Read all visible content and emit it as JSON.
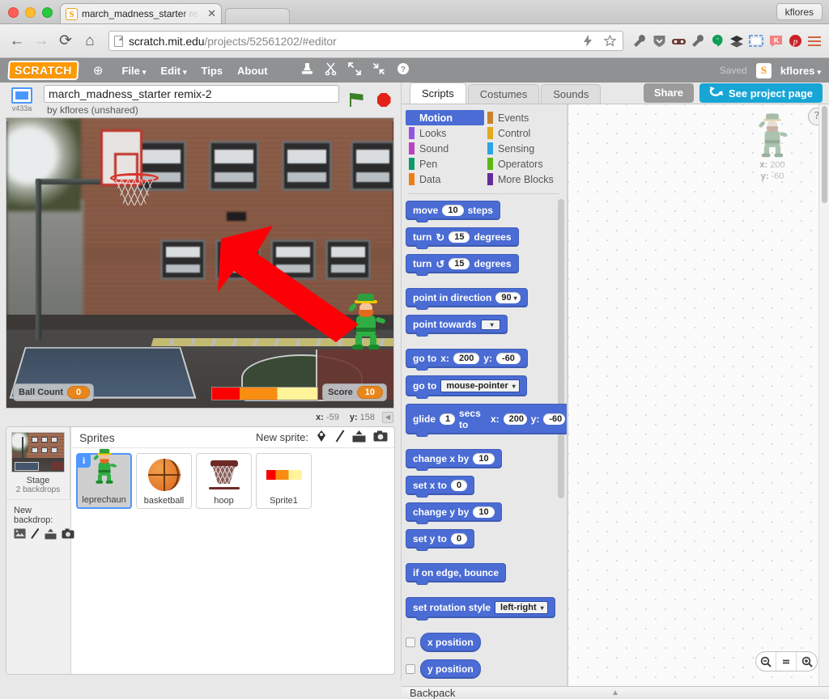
{
  "browser": {
    "tab": {
      "title_main": "march_madness_starter",
      "title_dim": " re",
      "close": "✕",
      "favicon": "S"
    },
    "profile_chip": "kflores",
    "back_icon": "←",
    "forward_icon": "→",
    "reload_icon": "⟳",
    "home_icon": "⌂",
    "url_main": "scratch.mit.edu",
    "url_dim": "/projects/52561202/#editor",
    "extensions": [
      "lightning-icon",
      "star-icon",
      "wrench-icon",
      "shield-icon",
      "mask-icon",
      "wrench2-icon",
      "hangouts-icon",
      "layers-icon",
      "window-icon",
      "k-icon",
      "pinterest-icon",
      "menu-icon"
    ]
  },
  "scratch_menu": {
    "logo": "SCRATCH",
    "globe_icon": "⊕",
    "items": [
      {
        "label": "File",
        "caret": "▾"
      },
      {
        "label": "Edit",
        "caret": "▾"
      },
      {
        "label": "Tips",
        "caret": ""
      },
      {
        "label": "About",
        "caret": ""
      }
    ],
    "tools": [
      "stamp-icon",
      "scissors-icon",
      "grow-icon",
      "shrink-icon",
      "help-icon"
    ],
    "saved_status": "Saved",
    "user_badge": "S",
    "username": "kflores",
    "username_caret": "▾"
  },
  "project": {
    "version_label": "v433a",
    "title_value": "march_madness_starter remix-2",
    "title_placeholder": "Project title",
    "byline": "by kflores (unshared)",
    "green_flag": "green-flag",
    "stop": "stop-sign"
  },
  "stage": {
    "watchers": [
      {
        "label": "Ball Count",
        "value": "0"
      },
      {
        "label": "Score",
        "value": "10"
      }
    ],
    "mouse_x_label": "x:",
    "mouse_x": "-59",
    "mouse_y_label": "y:",
    "mouse_y": "158",
    "collapse_arrow": "◀"
  },
  "sprite_pane": {
    "stage_name": "Stage",
    "stage_sub": "2 backdrops",
    "sprites_title": "Sprites",
    "new_sprite_label": "New sprite:",
    "new_sprite_icons": [
      "library-icon",
      "paint-icon",
      "upload-icon",
      "camera-icon"
    ],
    "new_backdrop_label": "New backdrop:",
    "new_backdrop_icons": [
      "library-icon",
      "paint-icon",
      "upload-icon",
      "camera-icon"
    ],
    "sprites": [
      {
        "name": "leprechaun",
        "selected": true,
        "badge": "i"
      },
      {
        "name": "basketball",
        "selected": false
      },
      {
        "name": "hoop",
        "selected": false
      },
      {
        "name": "Sprite1",
        "selected": false
      }
    ]
  },
  "editor": {
    "tabs": [
      {
        "label": "Scripts",
        "active": true
      },
      {
        "label": "Costumes",
        "active": false
      },
      {
        "label": "Sounds",
        "active": false
      }
    ],
    "share_label": "Share",
    "project_page_label": "See project page",
    "help_icon": "?",
    "backpack_label": "Backpack",
    "backpack_arrow": "▲",
    "zoom_out": "−",
    "zoom_reset": "=",
    "zoom_in": "+",
    "watermark": {
      "x_label": "x:",
      "x_value": "200",
      "y_label": "y:",
      "y_value": "-60"
    }
  },
  "categories": [
    {
      "label": "Motion",
      "color": "#4a6cd4",
      "active": true
    },
    {
      "label": "Events",
      "color": "#c88330",
      "active": false
    },
    {
      "label": "Looks",
      "color": "#8f56e3",
      "active": false
    },
    {
      "label": "Control",
      "color": "#e1a91a",
      "active": false
    },
    {
      "label": "Sound",
      "color": "#bb42c3",
      "active": false
    },
    {
      "label": "Sensing",
      "color": "#2ca5e2",
      "active": false
    },
    {
      "label": "Pen",
      "color": "#0e9a6c",
      "active": false
    },
    {
      "label": "Operators",
      "color": "#5cb712",
      "active": false
    },
    {
      "label": "Data",
      "color": "#ee7d16",
      "active": false
    },
    {
      "label": "More Blocks",
      "color": "#632d99",
      "active": false
    }
  ],
  "blocks": {
    "move": {
      "w1": "move",
      "v1": "10",
      "w2": "steps"
    },
    "turn_cw": {
      "w1": "turn",
      "icon": "↻",
      "v1": "15",
      "w2": "degrees"
    },
    "turn_ccw": {
      "w1": "turn",
      "icon": "↺",
      "v1": "15",
      "w2": "degrees"
    },
    "point_dir": {
      "w1": "point in direction",
      "v1": "90",
      "caret": "▾"
    },
    "point_tw": {
      "w1": "point towards",
      "v1": "",
      "caret": "▾"
    },
    "goto_xy": {
      "w1": "go to",
      "xl": "x:",
      "x": "200",
      "yl": "y:",
      "y": "-60"
    },
    "goto_target": {
      "w1": "go to",
      "v1": "mouse-pointer",
      "caret": "▾"
    },
    "glide": {
      "w1": "glide",
      "secs": "1",
      "w2": "secs to",
      "xl": "x:",
      "x": "200",
      "yl": "y:",
      "y": "-60"
    },
    "change_x": {
      "w1": "change x by",
      "v1": "10"
    },
    "set_x": {
      "w1": "set x to",
      "v1": "0"
    },
    "change_y": {
      "w1": "change y by",
      "v1": "10"
    },
    "set_y": {
      "w1": "set y to",
      "v1": "0"
    },
    "bounce": {
      "w1": "if on edge, bounce"
    },
    "rotation": {
      "w1": "set rotation style",
      "v1": "left-right",
      "caret": "▾"
    },
    "x_position": {
      "w1": "x position"
    },
    "y_position": {
      "w1": "y position"
    }
  }
}
